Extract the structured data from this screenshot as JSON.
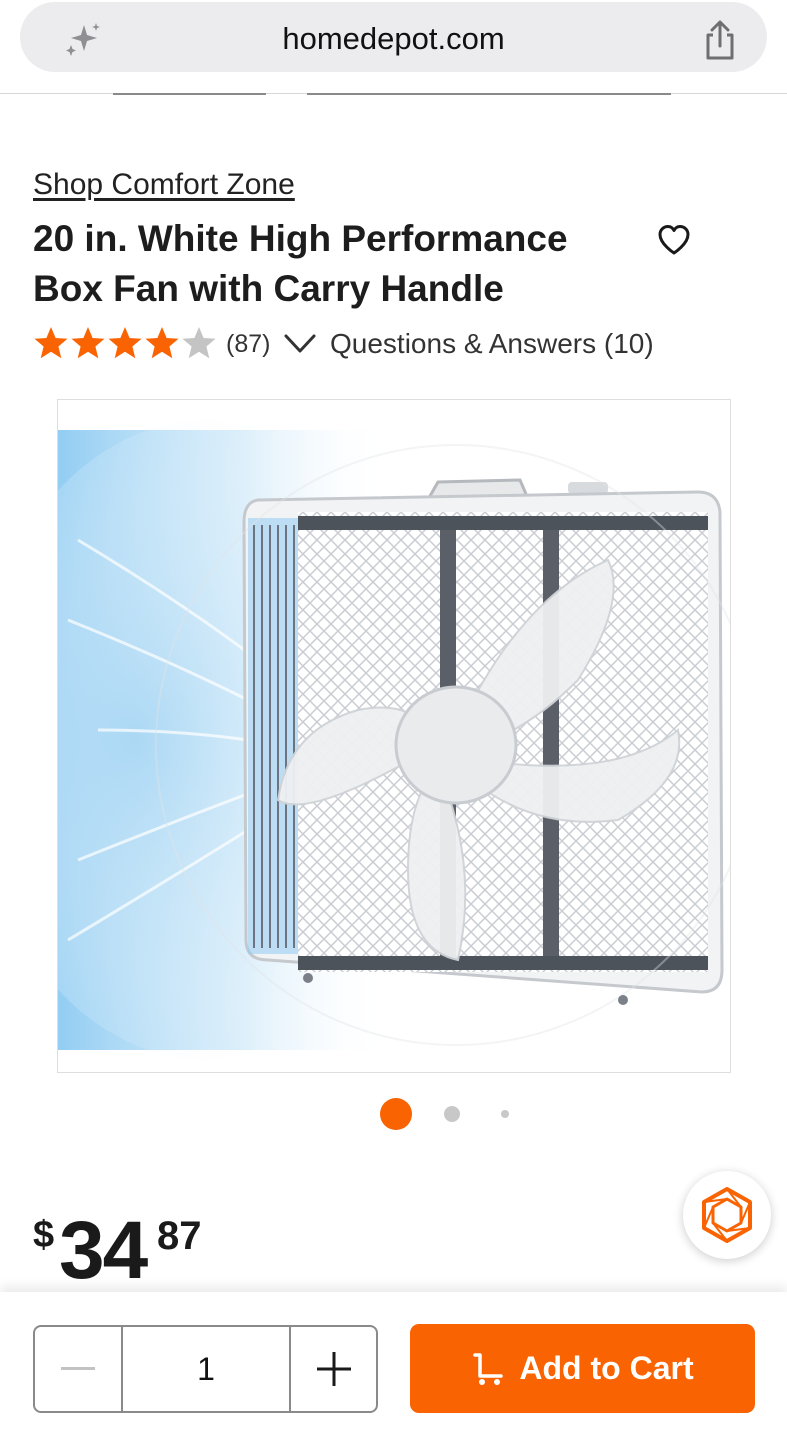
{
  "browser": {
    "url": "homedepot.com",
    "sparkle_icon": "sparkle-icon",
    "share_icon": "share-icon"
  },
  "product": {
    "brand_link": "Shop Comfort Zone",
    "title": "20 in. White High Performance Box Fan with Carry Handle",
    "rating_stars": 4,
    "rating_max": 5,
    "review_count": "(87)",
    "qa_link": "Questions & Answers (10)"
  },
  "gallery": {
    "image_count": 3,
    "active_index": 0
  },
  "price": {
    "currency": "$",
    "dollars": "34",
    "cents": "87"
  },
  "purchase": {
    "quantity": "1",
    "add_to_cart": "Add to Cart"
  },
  "colors": {
    "brand_orange": "#f96302",
    "star_filled": "#f96302",
    "star_empty": "#c4c4c4"
  }
}
